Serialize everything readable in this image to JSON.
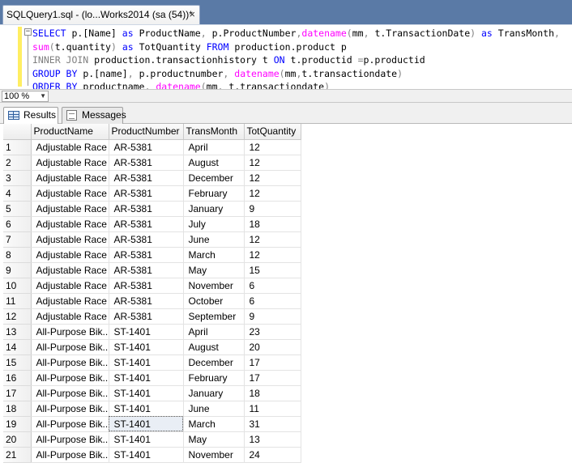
{
  "document_tab": {
    "title": "SQLQuery1.sql - (lo...Works2014 (sa (54))*",
    "close_glyph": "×"
  },
  "editor": {
    "collapse_glyph": "−",
    "lines": [
      [
        [
          "kw",
          "SELECT"
        ],
        [
          "",
          "p.[Name] "
        ],
        [
          "kw",
          "as"
        ],
        [
          "",
          "ProductName"
        ],
        [
          "gr",
          ", "
        ],
        [
          "",
          "p.ProductNumber"
        ],
        [
          "gr",
          ","
        ],
        [
          "fn",
          "datename"
        ],
        [
          "gr",
          "("
        ],
        [
          "",
          "mm"
        ],
        [
          "gr",
          ", "
        ],
        [
          "",
          "t.TransactionDate"
        ],
        [
          "gr",
          ") "
        ],
        [
          "kw",
          "as"
        ],
        [
          "",
          "TransMonth"
        ],
        [
          "gr",
          ","
        ]
      ],
      [
        [
          "fn",
          "sum"
        ],
        [
          "gr",
          "("
        ],
        [
          "",
          "t.quantity"
        ],
        [
          "gr",
          ") "
        ],
        [
          "kw",
          "as"
        ],
        [
          "",
          "TotQuantity "
        ],
        [
          "kw",
          "FROM"
        ],
        [
          "",
          "production.product p"
        ]
      ],
      [
        [
          "gr",
          "INNER JOIN"
        ],
        [
          "",
          "production.transactionhistory t "
        ],
        [
          "kw",
          "ON"
        ],
        [
          "",
          "t.productid "
        ],
        [
          "gr",
          "="
        ],
        [
          "",
          "p.productid"
        ]
      ],
      [
        [
          "kw",
          "GROUP BY"
        ],
        [
          "",
          "p.[name]"
        ],
        [
          "gr",
          ", "
        ],
        [
          "",
          "p.productnumber"
        ],
        [
          "gr",
          ", "
        ],
        [
          "fn",
          "datename"
        ],
        [
          "gr",
          "("
        ],
        [
          "",
          "mm"
        ],
        [
          "gr",
          ","
        ],
        [
          "",
          "t.transactiondate"
        ],
        [
          "gr",
          ")"
        ]
      ],
      [
        [
          "kw",
          "ORDER BY"
        ],
        [
          "",
          "productname"
        ],
        [
          "gr",
          ", "
        ],
        [
          "fn",
          "datename"
        ],
        [
          "gr",
          "("
        ],
        [
          "",
          "mm"
        ],
        [
          "gr",
          ", "
        ],
        [
          "",
          "t.transactiondate"
        ],
        [
          "gr",
          ")"
        ]
      ]
    ]
  },
  "zoom": {
    "value": "100 %",
    "chevron_glyph": "▼"
  },
  "result_tabs": {
    "results_label": "Results",
    "messages_label": "Messages"
  },
  "grid": {
    "columns": [
      "ProductName",
      "ProductNumber",
      "TransMonth",
      "TotQuantity"
    ],
    "selected": {
      "row": 18,
      "col": 1
    },
    "rows": [
      [
        "1",
        "Adjustable Race",
        "AR-5381",
        "April",
        "12"
      ],
      [
        "2",
        "Adjustable Race",
        "AR-5381",
        "August",
        "12"
      ],
      [
        "3",
        "Adjustable Race",
        "AR-5381",
        "December",
        "12"
      ],
      [
        "4",
        "Adjustable Race",
        "AR-5381",
        "February",
        "12"
      ],
      [
        "5",
        "Adjustable Race",
        "AR-5381",
        "January",
        "9"
      ],
      [
        "6",
        "Adjustable Race",
        "AR-5381",
        "July",
        "18"
      ],
      [
        "7",
        "Adjustable Race",
        "AR-5381",
        "June",
        "12"
      ],
      [
        "8",
        "Adjustable Race",
        "AR-5381",
        "March",
        "12"
      ],
      [
        "9",
        "Adjustable Race",
        "AR-5381",
        "May",
        "15"
      ],
      [
        "10",
        "Adjustable Race",
        "AR-5381",
        "November",
        "6"
      ],
      [
        "11",
        "Adjustable Race",
        "AR-5381",
        "October",
        "6"
      ],
      [
        "12",
        "Adjustable Race",
        "AR-5381",
        "September",
        "9"
      ],
      [
        "13",
        "All-Purpose Bik...",
        "ST-1401",
        "April",
        "23"
      ],
      [
        "14",
        "All-Purpose Bik...",
        "ST-1401",
        "August",
        "20"
      ],
      [
        "15",
        "All-Purpose Bik...",
        "ST-1401",
        "December",
        "17"
      ],
      [
        "16",
        "All-Purpose Bik...",
        "ST-1401",
        "February",
        "17"
      ],
      [
        "17",
        "All-Purpose Bik...",
        "ST-1401",
        "January",
        "18"
      ],
      [
        "18",
        "All-Purpose Bik...",
        "ST-1401",
        "June",
        "11"
      ],
      [
        "19",
        "All-Purpose Bik...",
        "ST-1401",
        "March",
        "31"
      ],
      [
        "20",
        "All-Purpose Bik...",
        "ST-1401",
        "May",
        "13"
      ],
      [
        "21",
        "All-Purpose Bik...",
        "ST-1401",
        "November",
        "24"
      ]
    ]
  }
}
